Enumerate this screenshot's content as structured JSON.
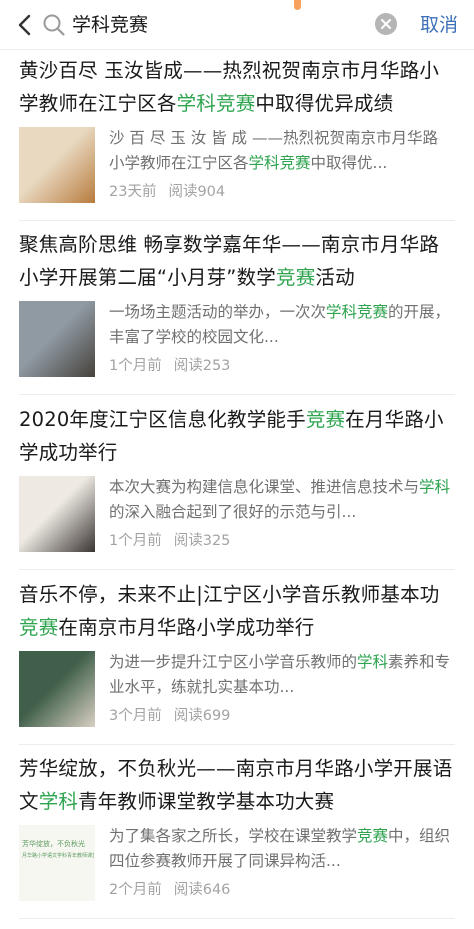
{
  "search": {
    "query": "学科竞赛",
    "cancel_label": "取消"
  },
  "results": [
    {
      "title_parts": [
        {
          "text": "黄沙百尽 玉汝皆成——热烈祝贺南京市月华路小学教师在江宁区各",
          "hl": false
        },
        {
          "text": "学科竞赛",
          "hl": true
        },
        {
          "text": "中取得优异成绩",
          "hl": false
        }
      ],
      "snippet_parts": [
        {
          "text": "沙 百 尽 玉 汝 皆 成 ——热烈祝贺南京市月华路小学教师在江宁区各",
          "hl": false
        },
        {
          "text": "学科竞赛",
          "hl": true
        },
        {
          "text": "中取得优...",
          "hl": false
        }
      ],
      "time": "23天前",
      "reads": "阅读904",
      "thumb_colors": [
        "#e9d9c1",
        "#b77b3d"
      ]
    },
    {
      "title_parts": [
        {
          "text": "聚焦高阶思维 畅享数学嘉年华——南京市月华路小学开展第二届“小月芽”数学",
          "hl": false
        },
        {
          "text": "竞赛",
          "hl": true
        },
        {
          "text": "活动",
          "hl": false
        }
      ],
      "snippet_parts": [
        {
          "text": "一场场主题活动的举办，一次次",
          "hl": false
        },
        {
          "text": "学科竞赛",
          "hl": true
        },
        {
          "text": "的开展，丰富了学校的校园文化...",
          "hl": false
        }
      ],
      "time": "1个月前",
      "reads": "阅读253",
      "thumb_colors": [
        "#8f9aa3",
        "#46413a"
      ]
    },
    {
      "title_parts": [
        {
          "text": "2020年度江宁区信息化教学能手",
          "hl": false
        },
        {
          "text": "竞赛",
          "hl": true
        },
        {
          "text": "在月华路小学成功举行",
          "hl": false
        }
      ],
      "snippet_parts": [
        {
          "text": "本次大赛为构建信息化课堂、推进信息技术与",
          "hl": false
        },
        {
          "text": "学科",
          "hl": true
        },
        {
          "text": "的深入融合起到了很好的示范与引...",
          "hl": false
        }
      ],
      "time": "1个月前",
      "reads": "阅读325",
      "thumb_colors": [
        "#eeeae3",
        "#3a3433"
      ]
    },
    {
      "title_parts": [
        {
          "text": "音乐不停，未来不止|江宁区小学音乐教师基本功",
          "hl": false
        },
        {
          "text": "竞赛",
          "hl": true
        },
        {
          "text": "在南京市月华路小学成功举行",
          "hl": false
        }
      ],
      "snippet_parts": [
        {
          "text": "为进一步提升江宁区小学音乐教师的",
          "hl": false
        },
        {
          "text": "学科",
          "hl": true
        },
        {
          "text": "素养和专业水平，练就扎实基本功...",
          "hl": false
        }
      ],
      "time": "3个月前",
      "reads": "阅读699",
      "thumb_colors": [
        "#3f5f4a",
        "#d9d0c3"
      ]
    },
    {
      "title_parts": [
        {
          "text": "芳华绽放，不负秋光——南京市月华路小学开展语文",
          "hl": false
        },
        {
          "text": "学科",
          "hl": true
        },
        {
          "text": "青年教师课堂教学基本功大赛",
          "hl": false
        }
      ],
      "snippet_parts": [
        {
          "text": "为了集各家之所长，学校在课堂教学",
          "hl": false
        },
        {
          "text": "竞赛",
          "hl": true
        },
        {
          "text": "中，组织四位参赛教师开展了同课异构活...",
          "hl": false
        }
      ],
      "time": "2个月前",
      "reads": "阅读646",
      "thumb_colors": [
        "#f7f7f2",
        "#5a9a5e"
      ],
      "thumb_text": [
        "芳华绽放，不负秋光",
        "月华路小学语文学科青年教师课堂教学基本功大赛"
      ]
    }
  ]
}
